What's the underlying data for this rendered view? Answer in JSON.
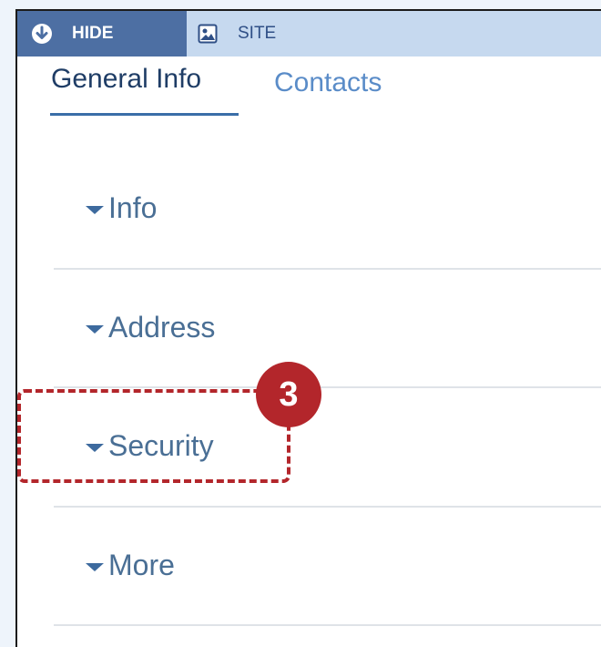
{
  "toolbar": {
    "hide_label": "HIDE",
    "hide_icon": "arrow-down-circle-icon",
    "site_label": "SITE",
    "site_icon": "image-icon"
  },
  "tabs": [
    {
      "label": "General Info",
      "active": true
    },
    {
      "label": "Contacts",
      "active": false
    }
  ],
  "sections": [
    {
      "label": "Info",
      "icon": "caret-down-icon"
    },
    {
      "label": "Address",
      "icon": "caret-down-icon"
    },
    {
      "label": "Security",
      "icon": "caret-down-icon"
    },
    {
      "label": "More",
      "icon": "caret-down-icon"
    }
  ],
  "callout": {
    "step_number": "3",
    "color": "#b3262b"
  },
  "colors": {
    "toolbar_bg": "#c6d9ef",
    "hide_button_bg": "#4d6fa3",
    "active_tab": "#1f3d66",
    "inactive_tab": "#5a8cc8",
    "section_text": "#4a6f95"
  }
}
